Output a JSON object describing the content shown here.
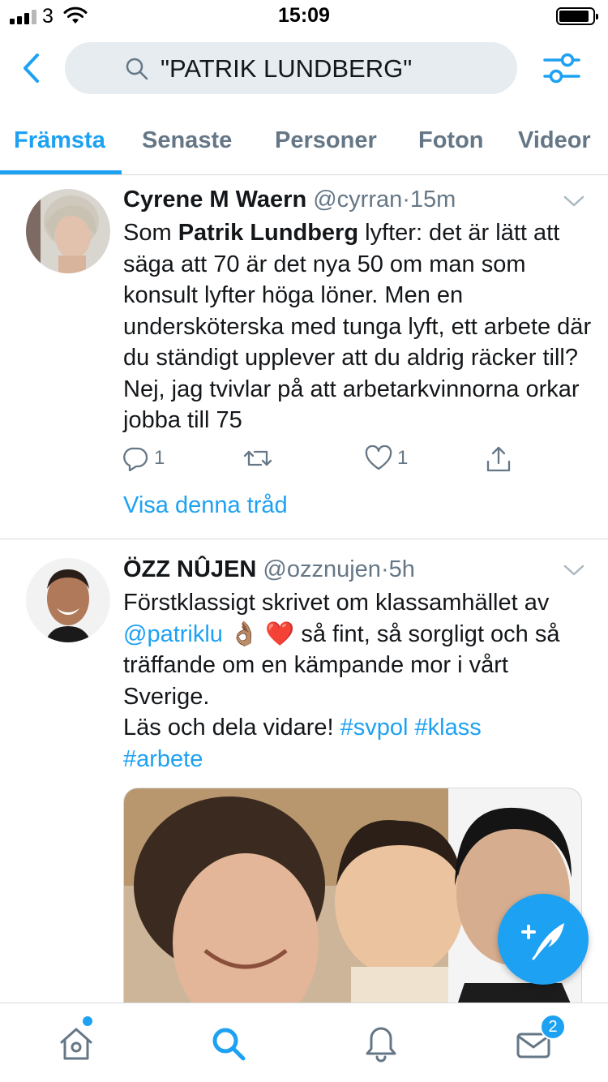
{
  "status_bar": {
    "carrier": "3",
    "time": "15:09"
  },
  "search": {
    "query": "\"PATRIK LUNDBERG\""
  },
  "tabs": [
    {
      "label": "Främsta",
      "active": true
    },
    {
      "label": "Senaste",
      "active": false
    },
    {
      "label": "Personer",
      "active": false
    },
    {
      "label": "Foton",
      "active": false
    },
    {
      "label": "Videor",
      "active": false
    }
  ],
  "tweets": [
    {
      "name": "Cyrene M Waern",
      "handle": "@cyrran",
      "separator": "·",
      "time": "15m",
      "text_pre": "Som ",
      "text_bold": "Patrik Lundberg",
      "text_post": " lyfter: det är lätt att säga att 70 är det nya 50 om man som konsult lyfter höga löner. Men en undersköterska med tunga lyft, ett arbete där du ständigt upplever att du aldrig räcker till? Nej, jag tvivlar på att arbetarkvinnorna orkar jobba till 75",
      "reply_count": "1",
      "like_count": "1",
      "show_thread": "Visa denna tråd"
    },
    {
      "name": "ÖZZ NÛJEN",
      "handle": "@ozznujen",
      "separator": "·",
      "time": "5h",
      "text_start": "Förstklassigt skrivet om klassamhället av",
      "mention": "@patriklu",
      "emojis": "👌🏽 ❤️",
      "text_mid": " så fint, så sorgligt och så träffande om en kämpande mor i vårt Sverige.",
      "text_line": "Läs och dela vidare!",
      "hashtag_1": "#svpol",
      "hashtag_2": "#klass",
      "hashtag_3": "#arbete"
    }
  ],
  "tabbar": {
    "notifications_badge": "2"
  },
  "colors": {
    "accent": "#1da1f2",
    "secondary_text": "#657786",
    "search_bg": "#e6ecf0"
  }
}
